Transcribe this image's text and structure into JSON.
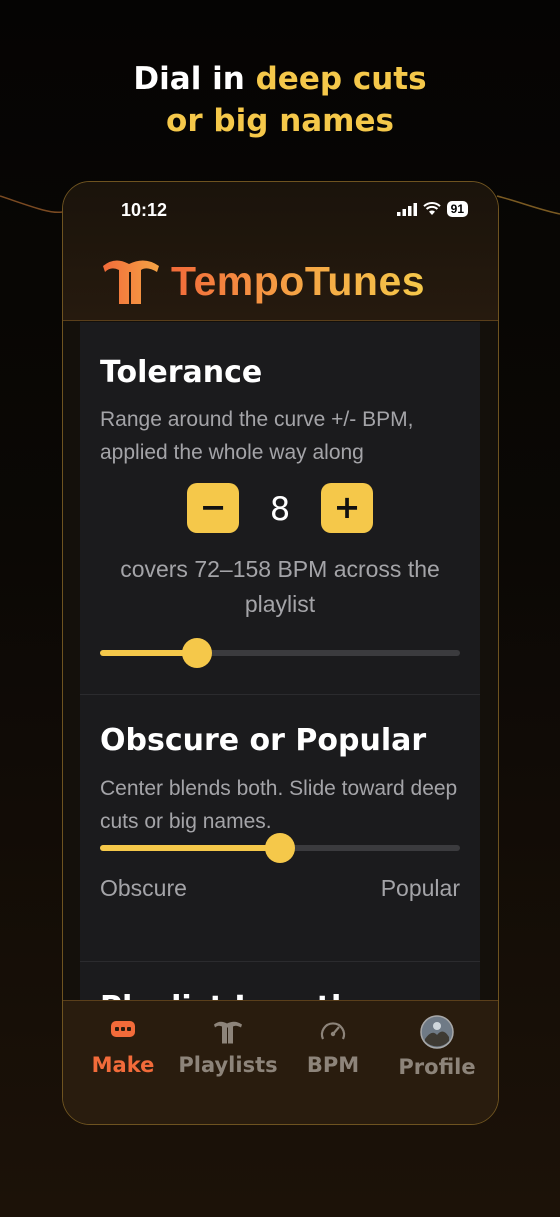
{
  "headline": {
    "line1_white": "Dial in ",
    "line1_highlight": "deep cuts",
    "line2_highlight": "or big names"
  },
  "status_bar": {
    "time": "10:12",
    "battery": "91"
  },
  "app": {
    "name": "TempoTunes"
  },
  "tolerance": {
    "title": "Tolerance",
    "description": "Range around the curve +/- BPM, applied the whole way along",
    "minus_label": "−",
    "plus_label": "+",
    "value": "8",
    "coverage_text": "covers 72–158 BPM across the playlist",
    "slider_level": 0.27
  },
  "obscure_popular": {
    "title": "Obscure or Popular",
    "description": "Center blends both. Slide toward deep cuts or big names.",
    "left_label": "Obscure",
    "right_label": "Popular",
    "slider_level": 0.5
  },
  "next_section": {
    "title": "Playlist Length"
  },
  "tabs": [
    {
      "label": "Make",
      "icon": "make-icon",
      "active": true
    },
    {
      "label": "Playlists",
      "icon": "tempotunes-logo-icon",
      "active": false
    },
    {
      "label": "BPM",
      "icon": "speedometer-icon",
      "active": false
    },
    {
      "label": "Profile",
      "icon": "avatar-icon",
      "active": false
    }
  ],
  "colors": {
    "accent": "#f5c84a",
    "active_tab": "#f26b3a",
    "brand_gradient_start": "#f26b3a",
    "brand_gradient_end": "#f5c84a"
  }
}
